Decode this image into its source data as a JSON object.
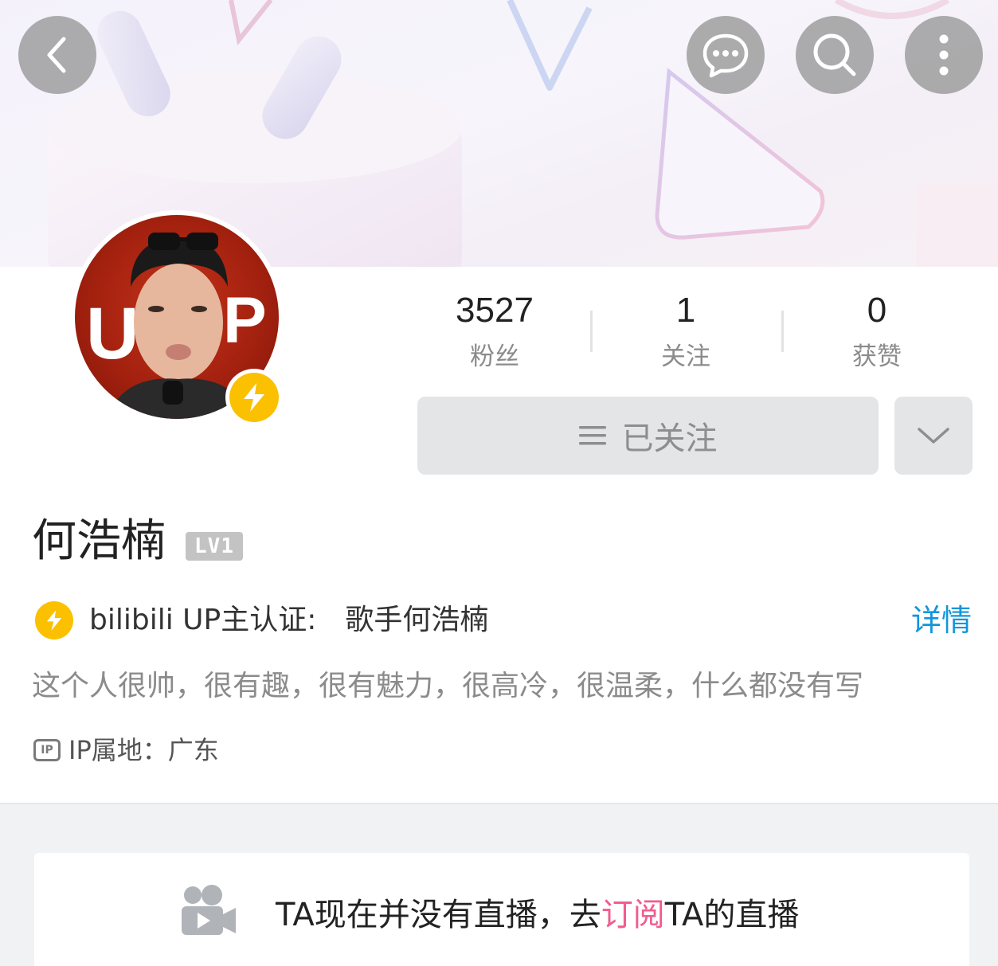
{
  "header": {
    "back_icon": "chevron-left-icon",
    "actions": [
      {
        "name": "message",
        "icon": "chat-bubble-icon"
      },
      {
        "name": "search",
        "icon": "search-icon"
      },
      {
        "name": "more",
        "icon": "more-vertical-icon"
      }
    ]
  },
  "profile": {
    "avatar_text": "UP",
    "stats": [
      {
        "value": "3527",
        "label": "粉丝"
      },
      {
        "value": "1",
        "label": "关注"
      },
      {
        "value": "0",
        "label": "获赞"
      }
    ],
    "follow_button_label": "已关注",
    "name": "何浩楠",
    "level_badge": "LV1",
    "verification_prefix": "bilibili UP主认证:",
    "verification_value": "歌手何浩楠",
    "details_label": "详情",
    "bio": "这个人很帅，很有趣，很有魅力，很高冷，很温柔，什么都没有写",
    "ip_icon_text": "IP",
    "ip_location": "IP属地：广东"
  },
  "live": {
    "text_before": "TA现在并没有直播，去",
    "link_text": "订阅",
    "text_after": "TA的直播"
  },
  "colors": {
    "accent_blue": "#1296db",
    "accent_pink": "#f25d8e",
    "up_badge_yellow": "#fbc000"
  }
}
